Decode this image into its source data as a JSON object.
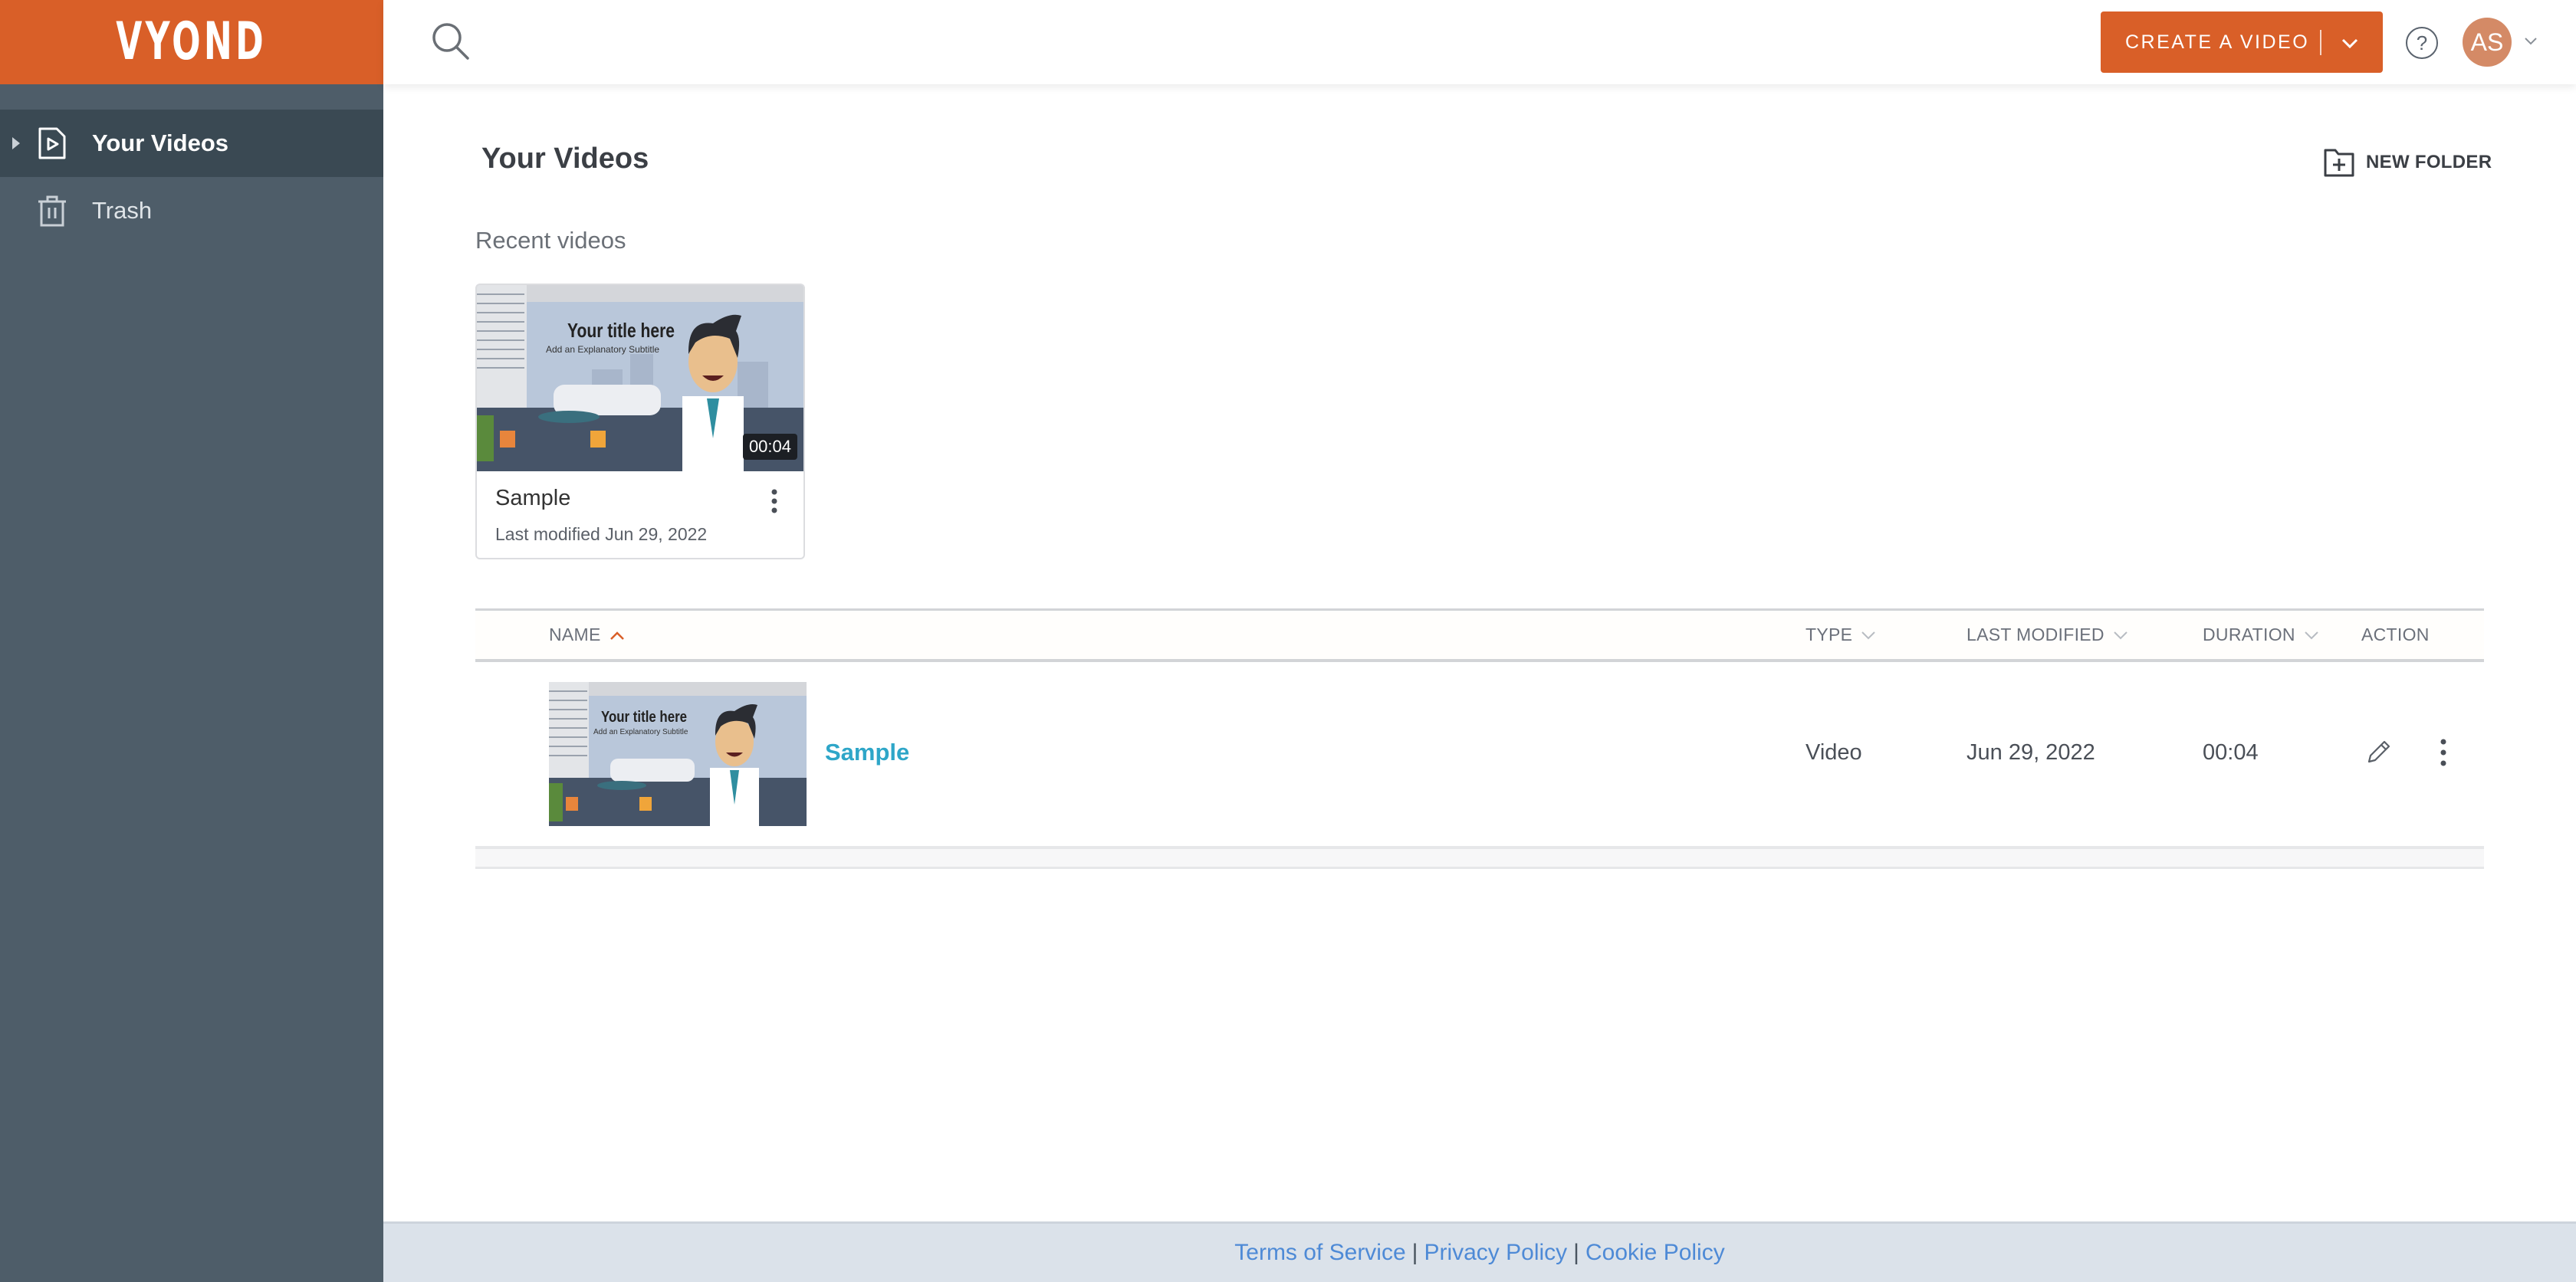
{
  "brand": {
    "logo_text": "VYOND",
    "accent_color": "#d95f28",
    "link_color": "#2ea6c8"
  },
  "sidebar": {
    "items": [
      {
        "label": "Your Videos",
        "icon": "video-file-icon",
        "active": true
      },
      {
        "label": "Trash",
        "icon": "trash-icon",
        "active": false
      }
    ]
  },
  "header": {
    "search_icon": "search-icon",
    "create_button_label": "CREATE A VIDEO",
    "help_icon": "help-icon",
    "avatar_initials": "AS"
  },
  "main": {
    "title": "Your Videos",
    "new_folder_label": "NEW FOLDER",
    "recent_label": "Recent videos",
    "recent_videos": [
      {
        "title": "Sample",
        "subtitle": "Last modified Jun 29, 2022",
        "duration": "00:04",
        "thumbnail": {
          "title": "Your title here",
          "subtitle": "Add an Explanatory Subtitle"
        }
      }
    ],
    "table": {
      "columns": [
        {
          "label": "NAME",
          "sort": "asc"
        },
        {
          "label": "TYPE",
          "sort": "none"
        },
        {
          "label": "LAST MODIFIED",
          "sort": "none"
        },
        {
          "label": "DURATION",
          "sort": "none"
        },
        {
          "label": "ACTION",
          "sort": null
        }
      ],
      "rows": [
        {
          "name": "Sample",
          "type": "Video",
          "last_modified": "Jun 29, 2022",
          "duration": "00:04",
          "thumbnail": {
            "title": "Your title here",
            "subtitle": "Add an Explanatory Subtitle"
          }
        }
      ]
    }
  },
  "footer": {
    "links": [
      "Terms of Service",
      "Privacy Policy",
      "Cookie Policy"
    ],
    "separator": "|"
  }
}
